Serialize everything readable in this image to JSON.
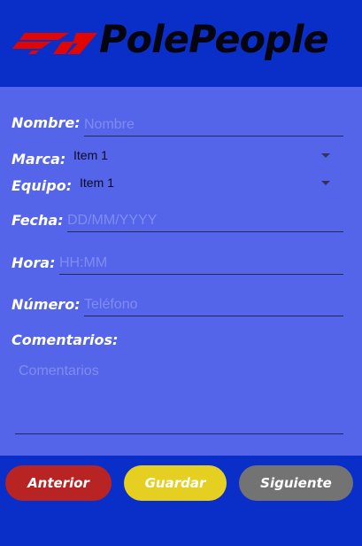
{
  "header": {
    "brand_name": "PolePeople",
    "logo_icon": "f1-logo-icon",
    "colors": {
      "background": "#0a2fc8",
      "logo_red": "#e10600"
    }
  },
  "form": {
    "background": "#5565e9",
    "nombre": {
      "label": "Nombre:",
      "placeholder": "Nombre"
    },
    "marca": {
      "label": "Marca:",
      "selected": "Item 1"
    },
    "equipo": {
      "label": "Equipo:",
      "selected": "Item 1"
    },
    "fecha": {
      "label": "Fecha:",
      "placeholder": "DD/MM/YYYY"
    },
    "hora": {
      "label": "Hora:",
      "placeholder": "HH:MM"
    },
    "numero": {
      "label": "Número:",
      "placeholder": "Teléfono"
    },
    "comentarios": {
      "label": "Comentarios:",
      "placeholder": "Comentarios"
    }
  },
  "buttons": {
    "anterior": {
      "label": "Anterior",
      "color": "#b82323"
    },
    "guardar": {
      "label": "Guardar",
      "color": "#e5cf21"
    },
    "siguiente": {
      "label": "Siguiente",
      "color": "#737373"
    }
  }
}
